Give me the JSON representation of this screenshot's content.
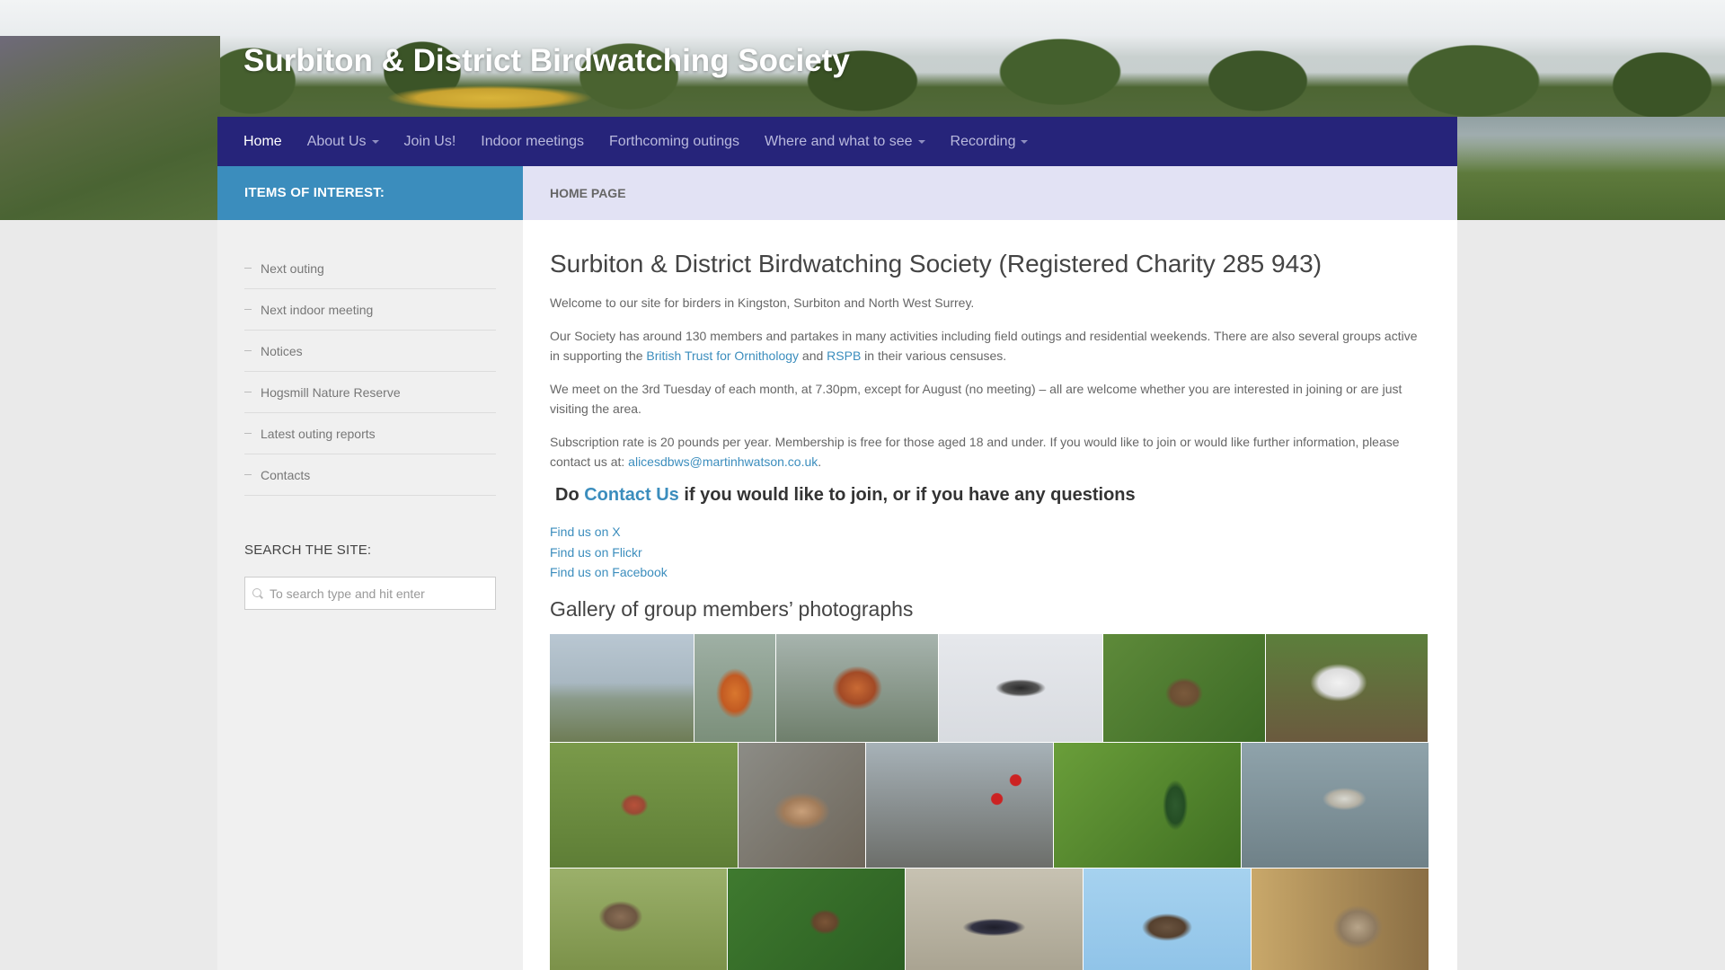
{
  "site": {
    "title": "Surbiton & District Birdwatching Society"
  },
  "nav": {
    "items": [
      {
        "label": "Home",
        "active": true,
        "dropdown": false
      },
      {
        "label": "About Us",
        "active": false,
        "dropdown": true
      },
      {
        "label": "Join Us!",
        "active": false,
        "dropdown": false
      },
      {
        "label": "Indoor meetings",
        "active": false,
        "dropdown": false
      },
      {
        "label": "Forthcoming outings",
        "active": false,
        "dropdown": false
      },
      {
        "label": "Where and what to see",
        "active": false,
        "dropdown": true
      },
      {
        "label": "Recording",
        "active": false,
        "dropdown": true
      }
    ]
  },
  "sidebar": {
    "heading": "Items of interest:",
    "items": [
      {
        "label": "Next outing"
      },
      {
        "label": "Next indoor meeting"
      },
      {
        "label": "Notices"
      },
      {
        "label": "Hogsmill Nature Reserve"
      },
      {
        "label": "Latest outing reports"
      },
      {
        "label": "Contacts"
      }
    ],
    "search_heading": "Search the site:",
    "search_placeholder": "To search type and hit enter"
  },
  "main": {
    "page_heading": "Home Page",
    "title": "Surbiton & District Birdwatching Society (Registered Charity 285 943)",
    "welcome": "Welcome to our site for birders in Kingston, Surbiton and North West Surrey.",
    "para1_start": "Our Society has around 130 members and partakes in many activities including field outings and residential weekends. There are also several groups active in supporting the ",
    "bto_link": "British Trust for Ornithology",
    "para1_and": " and ",
    "rspb_link": "RSPB",
    "para1_end": " in their various censuses.",
    "para2": "We meet on the 3rd Tuesday of each month, at 7.30pm, except for August (no meeting) – all are welcome whether you are interested in joining or are just visiting the area.",
    "para3_start": "Subscription rate is 20 pounds per year. Membership is free for those aged 18 and under.  If you would like to join or would like further information, please contact us at: ",
    "email_link": "alicesdbws@martinhwatson.co.uk",
    "para3_end": ".",
    "cta_do": "Do ",
    "cta_link": "Contact Us",
    "cta_rest": " if you would like to join, or if you have any questions",
    "social": [
      "Find us on X",
      "Find us on Flickr",
      "Find us on Facebook"
    ],
    "gallery_heading": "Gallery of group members’ photographs"
  },
  "colors": {
    "nav_bg": "#26247a",
    "sidebar_head_bg": "#3b8dbd",
    "page_head_bg": "#e2e2f4",
    "link": "#3b8dbd"
  },
  "gallery": {
    "photos": [
      {
        "subject": "estuary-marsh-photo"
      },
      {
        "subject": "redstart-photo"
      },
      {
        "subject": "redstart-branch-photo"
      },
      {
        "subject": "stork-flight-photo"
      },
      {
        "subject": "thrush-tree-photo"
      },
      {
        "subject": "stork-nest-photo"
      },
      {
        "subject": "linnet-photo"
      },
      {
        "subject": "slow-worm-photo"
      },
      {
        "subject": "redwing-berries-photo"
      },
      {
        "subject": "woodpecker-feeder-photo"
      },
      {
        "subject": "sandpiper-photo"
      },
      {
        "subject": "partridge-photo"
      },
      {
        "subject": "wren-photo"
      },
      {
        "subject": "magpie-photo"
      },
      {
        "subject": "buzzard-sky-photo"
      },
      {
        "subject": "fledgling-photo"
      }
    ]
  }
}
